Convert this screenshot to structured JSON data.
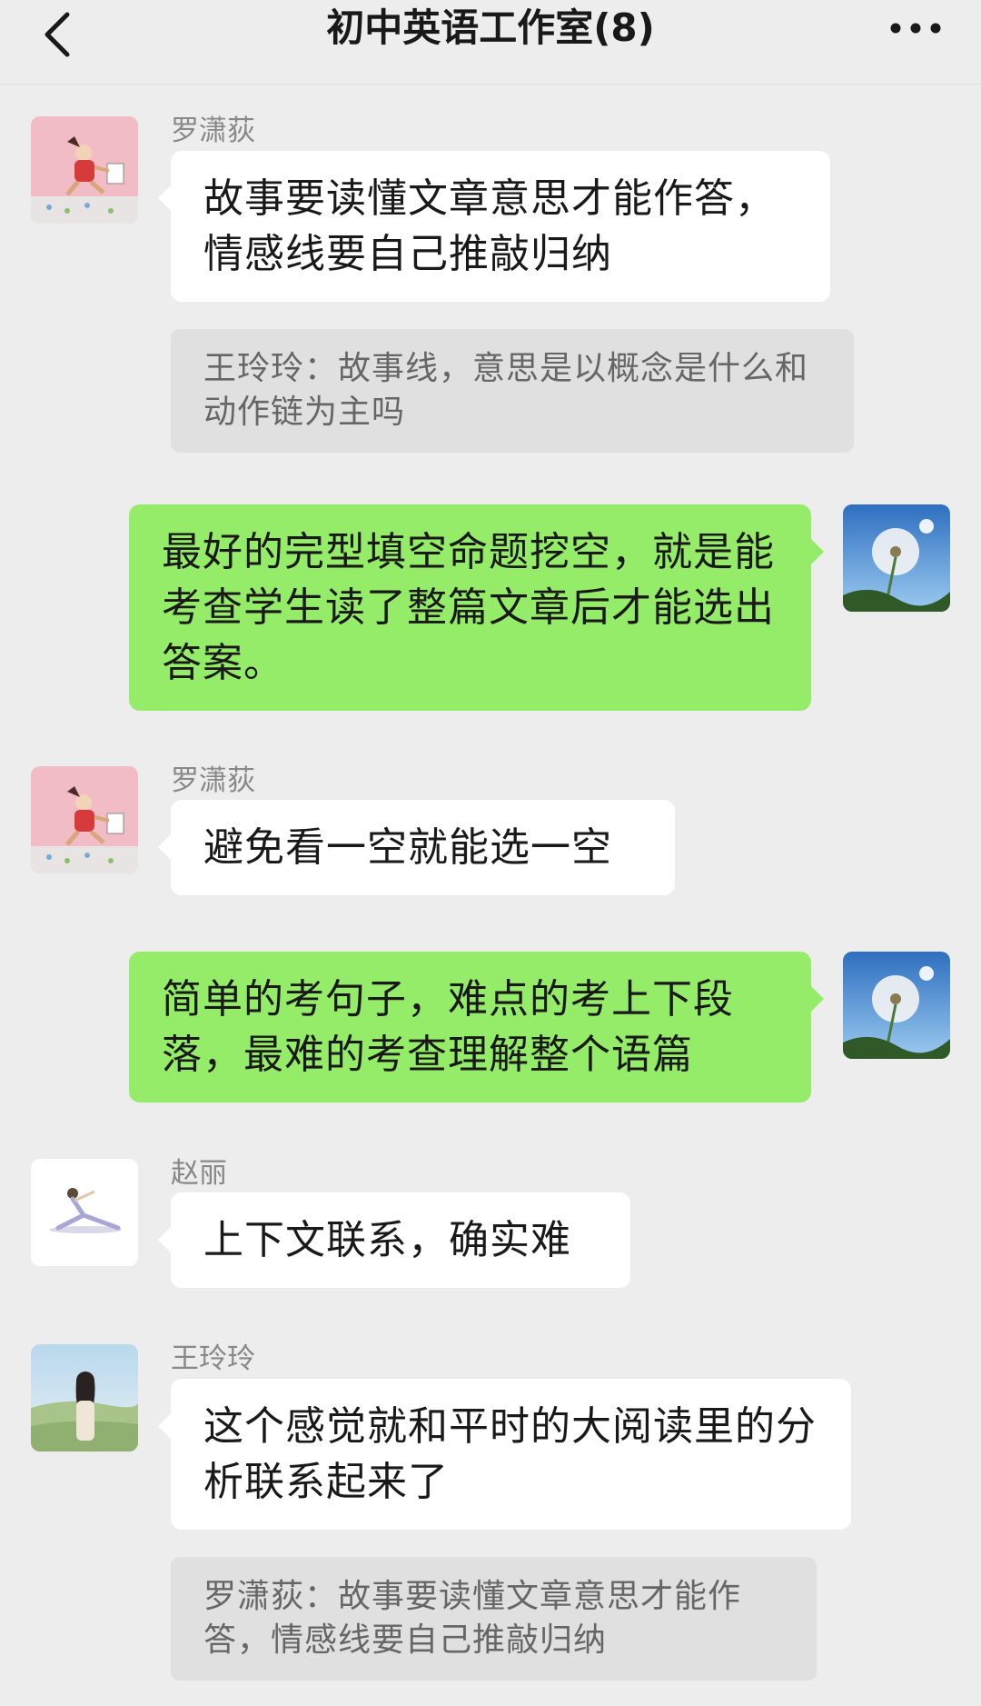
{
  "header": {
    "title": "初中英语工作室(8)",
    "back_icon": "chevron-left-icon",
    "more_icon": "more-horizontal-icon"
  },
  "messages": [
    {
      "side": "left",
      "sender": "罗潇荻",
      "text": "故事要读懂文章意思才能作答，情感线要自己推敲归纳",
      "quote": "王玲玲：故事线，意思是以概念是什么和动作链为主吗"
    },
    {
      "side": "right",
      "text": "最好的完型填空命题挖空，就是能考查学生读了整篇文章后才能选出答案。"
    },
    {
      "side": "left",
      "sender": "罗潇荻",
      "text": "避免看一空就能选一空"
    },
    {
      "side": "right",
      "text": "简单的考句子，难点的考上下段落，最难的考查理解整个语篇"
    },
    {
      "side": "left",
      "sender": "赵丽",
      "text": "上下文联系，确实难"
    },
    {
      "side": "left",
      "sender": "王玲玲",
      "text": "这个感觉就和平时的大阅读里的分析联系起来了",
      "quote": "罗潇荻：故事要读懂文章意思才能作答，情感线要自己推敲归纳"
    }
  ],
  "colors": {
    "background": "#ededed",
    "bubble_self": "#95ec69",
    "bubble_other": "#ffffff",
    "quote_bg": "#e0e0e0"
  }
}
